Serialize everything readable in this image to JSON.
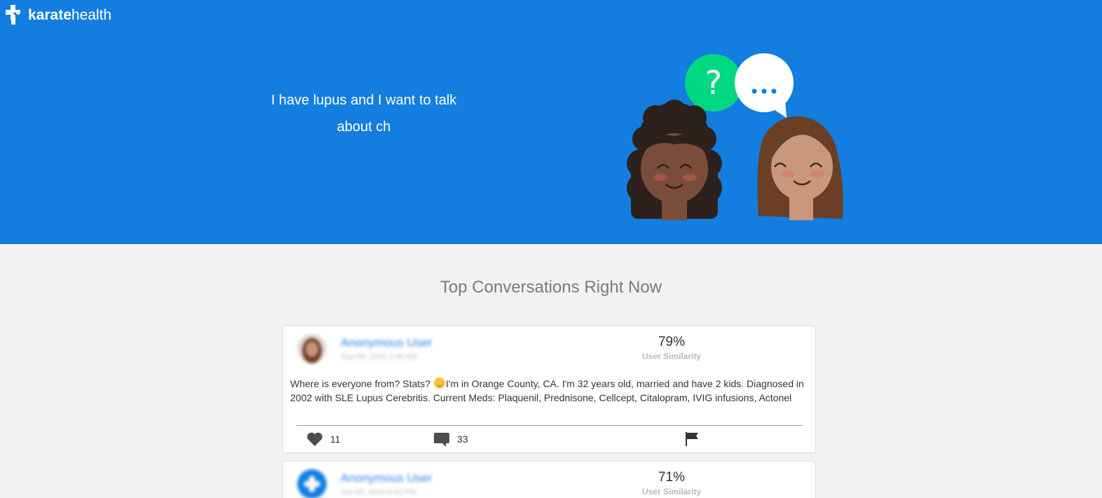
{
  "header": {
    "logo_bold": "karate",
    "logo_light": "health",
    "search_text": "I have lupus and I want to talk about ch"
  },
  "section": {
    "title": "Top Conversations Right Now"
  },
  "posts": [
    {
      "user_name": "Anonymous User",
      "date": "Sep 08, 2015 2:36 AM",
      "similarity": "79%",
      "similarity_label": "User Similarity",
      "text_before_emoji": "Where is everyone from? Stats? ",
      "emoji": "smiling-face",
      "text_after_emoji": "I'm in Orange County, CA. I'm 32 years old, married and have 2 kids. Diagnosed in 2002 with SLE Lupus Cerebritis. Current Meds: Plaquenil, Prednisone, Cellcept, Citalopram, IVIG infusions, Actonel",
      "likes": "11",
      "comments": "33"
    },
    {
      "user_name": "Anonymous User",
      "date": "Jun 08, 2015 6:02 PM",
      "similarity": "71%",
      "similarity_label": "User Similarity"
    }
  ],
  "colors": {
    "hero": "#137de0",
    "page": "#f2f2f2",
    "accent_green": "#00d882"
  }
}
